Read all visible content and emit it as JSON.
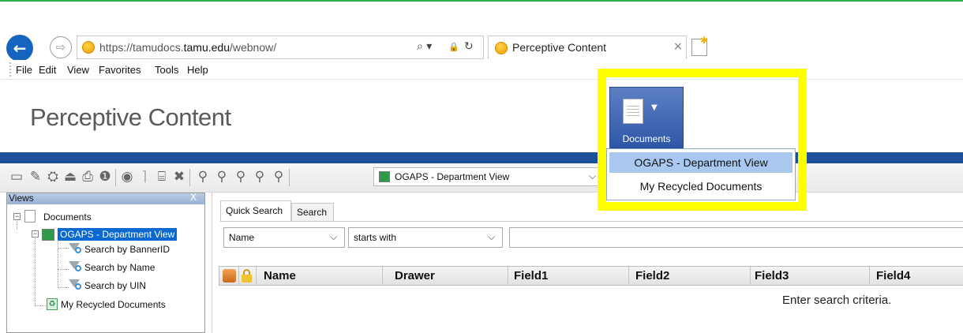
{
  "browser": {
    "url_prefix": "https://tamudocs.",
    "url_domain": "tamu.edu",
    "url_suffix": "/webnow/",
    "search_icon": "⌕ ▾",
    "lock_icon": "🔒",
    "refresh_icon": "↻",
    "tab_title": "Perceptive Content",
    "tab_close": "×"
  },
  "menu": {
    "items": [
      "File",
      "Edit",
      "View",
      "Favorites",
      "Tools",
      "Help"
    ]
  },
  "app": {
    "title": "Perceptive Content",
    "accent_color": "#1d4f9c"
  },
  "toolbar": {
    "view_select": "OGAPS - Department View",
    "arrow": "⌵"
  },
  "views_pane": {
    "title": "Views",
    "close": "X",
    "tree": {
      "root": "Documents",
      "selected_view": "OGAPS - Department View",
      "searches": [
        "Search by BannerID",
        "Search by Name",
        "Search by UIN"
      ],
      "recycled": "My Recycled Documents"
    }
  },
  "search_panel": {
    "tabs": [
      "Quick Search",
      "Search"
    ],
    "field_dropdown": "Name",
    "operator_dropdown": "starts with",
    "columns": [
      "Name",
      "Drawer",
      "Field1",
      "Field2",
      "Field3",
      "Field4"
    ],
    "empty_message": "Enter search criteria."
  },
  "documents_popup": {
    "button_label": "Documents",
    "items": [
      "OGAPS - Department View",
      "My Recycled Documents"
    ],
    "highlight_color": "#ffff00"
  }
}
